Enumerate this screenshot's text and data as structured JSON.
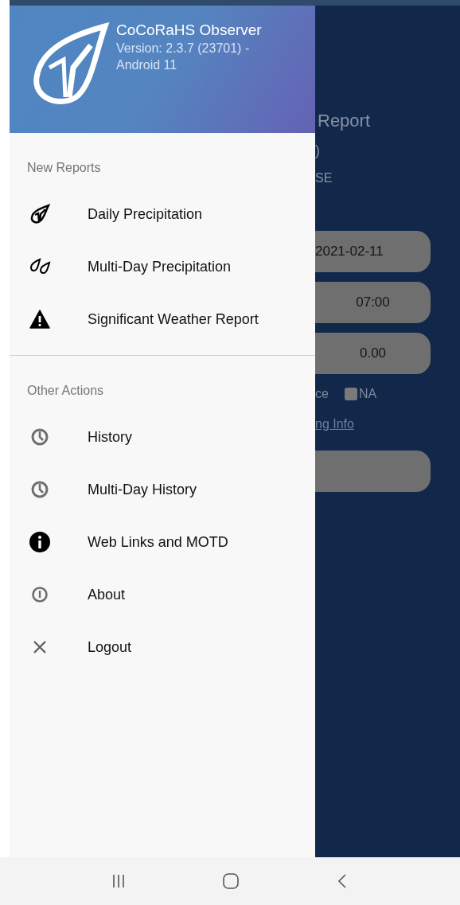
{
  "drawer": {
    "title": "CoCoRaHS Observer",
    "version": "Version: 2.3.7 (23701) -\nAndroid 11",
    "sections": [
      {
        "title": "New Reports",
        "items": [
          {
            "label": "Daily Precipitation",
            "kind": "gauge"
          },
          {
            "label": "Multi-Day Precipitation",
            "kind": "multi-gauge"
          },
          {
            "label": "Significant Weather Report",
            "kind": "warning"
          }
        ]
      },
      {
        "title": "Other Actions",
        "items": [
          {
            "label": "History",
            "kind": "clock"
          },
          {
            "label": "Multi-Day History",
            "kind": "clock"
          },
          {
            "label": "Web Links and MOTD",
            "kind": "info"
          },
          {
            "label": "About",
            "kind": "about"
          },
          {
            "label": "Logout",
            "kind": "close"
          }
        ]
      }
    ]
  },
  "background": {
    "title": "Report",
    "line_1": ")",
    "line_2": "SE",
    "fields": [
      "2021-02-11",
      "07:00",
      "0.00"
    ],
    "trace_label": "ce",
    "na_checkbox": {
      "label": "NA",
      "checked": false
    },
    "link": "ng Info"
  }
}
